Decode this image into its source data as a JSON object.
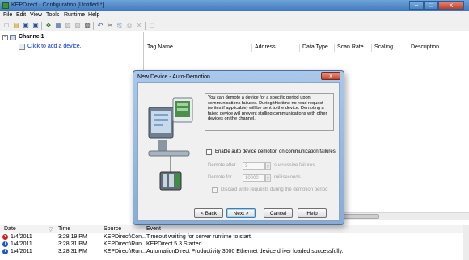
{
  "app": {
    "title": "KEPDirect - Configuration [Untitled *]",
    "window_controls": {
      "minimize": "–",
      "maximize": "□",
      "close": "x"
    }
  },
  "menu": [
    "File",
    "Edit",
    "View",
    "Tools",
    "Runtime",
    "Help"
  ],
  "toolbar": {
    "icons": [
      "new-icon",
      "open-icon",
      "save-icon",
      "save-as-icon",
      "new-channel-icon",
      "new-device-icon",
      "new-group-icon",
      "new-tag-icon",
      "properties-icon",
      "undo-icon",
      "cut-icon",
      "copy-icon",
      "paste-icon",
      "delete-icon",
      "quick-client-icon"
    ],
    "glyphs": [
      "□",
      "▤",
      "▣",
      "▣",
      "❖",
      "▦",
      "▧",
      "▨",
      "▩",
      "↶",
      "✂",
      "⎘",
      "⎙",
      "✕",
      "▢"
    ]
  },
  "tree": {
    "channel_label": "Channel1",
    "expander": "−",
    "add_device_label": "Click to add a device."
  },
  "grid": {
    "columns": [
      "Tag Name",
      "Address",
      "Data Type",
      "Scan Rate",
      "Scaling",
      "Description"
    ]
  },
  "log": {
    "columns": [
      "Date",
      "Time",
      "Source",
      "Event"
    ],
    "sort_glyph": "▽",
    "rows": [
      {
        "type": "error",
        "date": "1/4/2011",
        "time": "3:28:19 PM",
        "source": "KEPDirect\\Con...",
        "event": "Timeout waiting for server runtime to start."
      },
      {
        "type": "info",
        "date": "1/4/2011",
        "time": "3:28:31 PM",
        "source": "KEPDirect\\Run...",
        "event": "KEPDirect 5.3 Started"
      },
      {
        "type": "info",
        "date": "1/4/2011",
        "time": "3:28:31 PM",
        "source": "KEPDirect\\Run...",
        "event": "AutomationDirect Productivity 3000 Ethernet device driver loaded successfully."
      }
    ]
  },
  "dialog": {
    "title": "New Device - Auto-Demotion",
    "close_glyph": "x",
    "description": "You can demote a device for a specific period upon communications failures. During this time no read request (writes if applicable) will be sent to the device. Demoting a failed device will prevent stalling communications with other devices on the channel.",
    "enable_label": "Enable auto device demotion on communication failures",
    "demote_after_label": "Demote after",
    "demote_after_value": "3",
    "demote_after_unit": "successive failures",
    "demote_for_label": "Demote for",
    "demote_for_value": "10000",
    "demote_for_unit": "milliseconds",
    "discard_label": "Discard write requests during the demotion period",
    "buttons": {
      "back": "< Back",
      "next": "Next >",
      "cancel": "Cancel",
      "help": "Help"
    }
  }
}
